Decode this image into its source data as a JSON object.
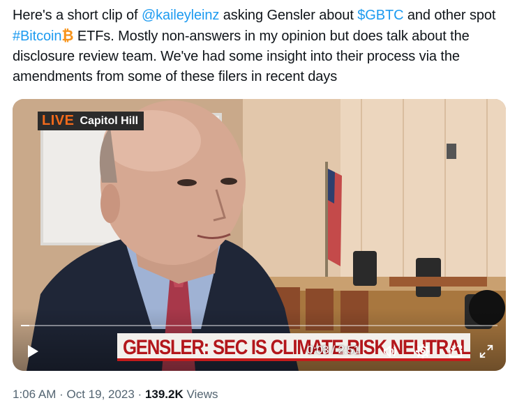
{
  "tweet": {
    "text_1": "Here's a short clip of ",
    "mention": "@kaileyleinz",
    "text_2": " asking Gensler about ",
    "cashtag": "$GBTC",
    "text_3": " and other spot ",
    "hashtag": "#Bitcoin",
    "btc_glyph": "₿",
    "text_4": " ETFs. Mostly non-answers in my opinion but does talk about the disclosure review team. We've had some insight into their process via the amendments from some of these filers in recent days"
  },
  "video": {
    "live_label": "LIVE",
    "location_label": "Capitol Hill",
    "chyron": "GENSLER: SEC IS CLIMATE RISK NEUTRAL",
    "current_time": "0:03",
    "separator": " / ",
    "duration": "2:51",
    "progress_fraction": 0.0175,
    "icons": {
      "play": "play-icon",
      "volume": "volume-icon",
      "settings": "gear-icon",
      "pip": "picture-in-picture-icon",
      "fullscreen": "fullscreen-icon"
    },
    "colors": {
      "live": "#f26a1b",
      "chyron_text": "#b3161b",
      "chyron_rule": "#c41b1b"
    }
  },
  "meta": {
    "time": "1:06 AM",
    "dot_1": " · ",
    "date": "Oct 19, 2023",
    "dot_2": " · ",
    "views_count": "139.2K",
    "views_label": " Views"
  },
  "colors": {
    "link": "#1d9bf0",
    "text": "#0f1419",
    "muted": "#536471",
    "bitcoin": "#f7931a"
  }
}
